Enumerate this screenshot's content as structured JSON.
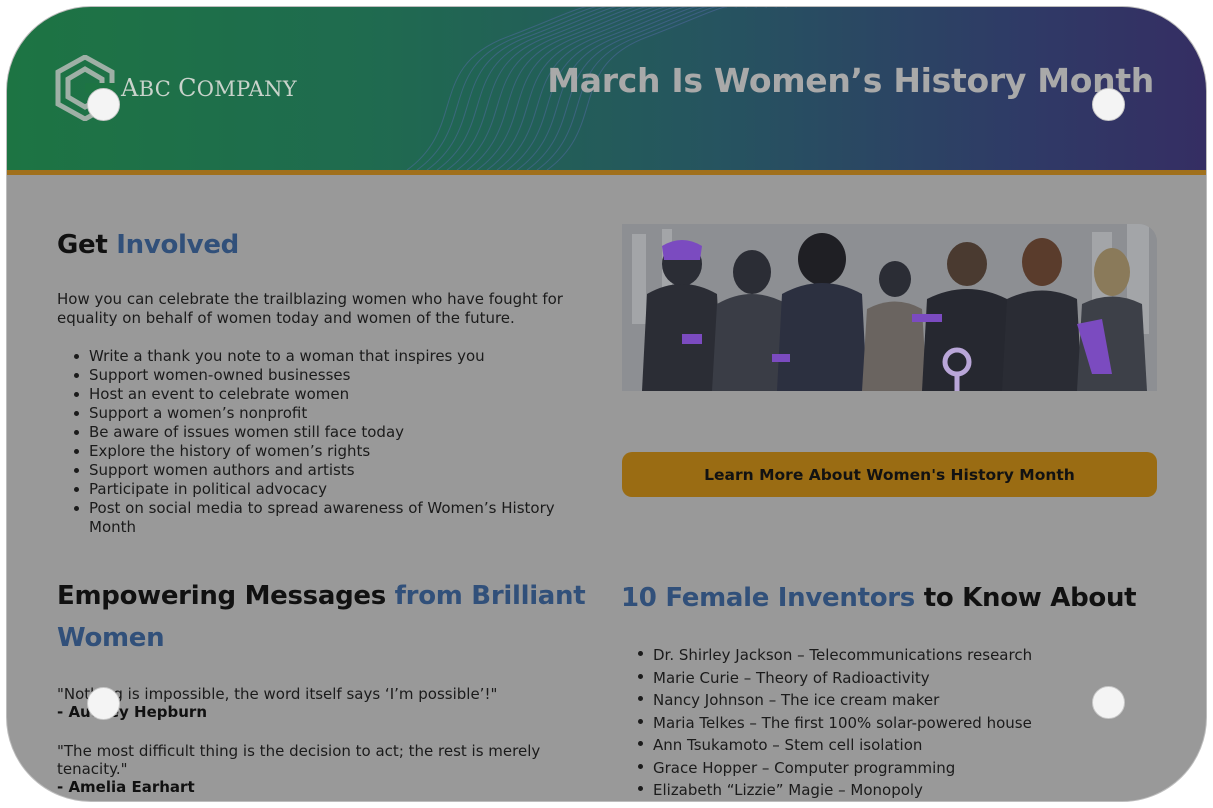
{
  "header": {
    "logo_text_first": "A",
    "logo_text_rest": "BC ",
    "logo_text_c": "C",
    "logo_text_rest2": "OMPANY",
    "title": "March Is Women’s History Month"
  },
  "involved": {
    "title_plain": "Get ",
    "title_accent": "Involved",
    "intro": "How you can celebrate the trailblazing women who have fought for equality on behalf of women today and women of the future.",
    "items": [
      "Write a thank you note to a woman that inspires you",
      "Support women-owned businesses",
      "Host an event to celebrate women",
      "Support a women’s nonprofit",
      "Be aware of issues women still face today",
      "Explore the history of women’s rights",
      "Support women authors and artists",
      "Participate in political advocacy",
      "Post on social media to spread awareness of Women’s History Month"
    ]
  },
  "cta": {
    "label": "Learn More About Women's History Month"
  },
  "empower": {
    "title_plain": "Empowering Messages ",
    "title_accent": "from Brilliant Women",
    "quotes": [
      {
        "text": "\"Nothing is impossible, the word itself says ‘I’m possible’!\"",
        "author": "- Audrey Hepburn"
      },
      {
        "text": "\"The most difficult thing is the decision to act; the rest is merely tenacity.\"",
        "author": "- Amelia Earhart"
      }
    ]
  },
  "inventors": {
    "title_accent": "10 Female Inventors",
    "title_plain": " to Know About",
    "items": [
      "Dr. Shirley Jackson – Telecommunications research",
      "Marie Curie – Theory of Radioactivity",
      "Nancy Johnson – The ice cream maker",
      "Maria Telkes – The first 100% solar-powered house",
      "Ann Tsukamoto – Stem cell isolation",
      "Grace Hopper – Computer programming",
      "Elizabeth “Lizzie” Magie – Monopoly"
    ]
  },
  "colors": {
    "accent_blue": "#31507a",
    "button_gold": "#9a6c13",
    "header_green": "#1d7443",
    "header_purple": "#352e63"
  }
}
